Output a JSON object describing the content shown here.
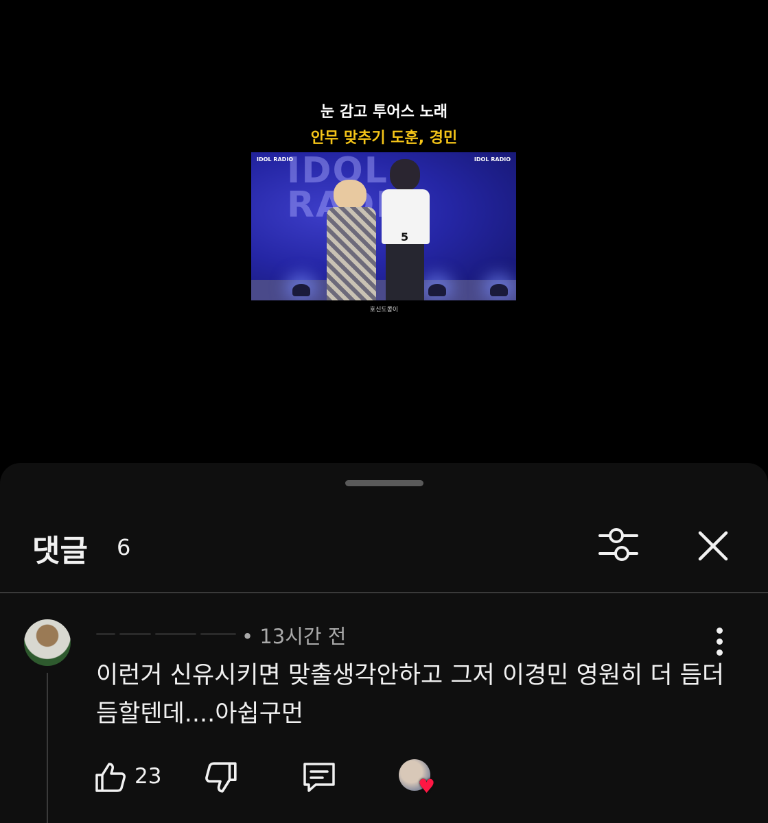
{
  "video": {
    "caption_line1": "눈 감고 투어스 노래",
    "caption_line2": "안무 맞추기 도훈, 경민",
    "thumbnail_text": "IDOL RADIO",
    "logo_left": "IDOL RADIO",
    "logo_right": "IDOL RADIO",
    "jersey_number": "5",
    "watermark": "호신도콩이",
    "caption_highlight_color": "#f5c518"
  },
  "comments_sheet": {
    "title": "댓글",
    "count": "6",
    "filter_icon": "sliders-icon",
    "close_icon": "close-icon"
  },
  "comment": {
    "time": "• 13시간 전",
    "text": "이런거 신유시키면 맞출생각안하고 그저 이경민 영원히 더 듬더듬할텐데....아쉽구먼",
    "likes": "23",
    "like_icon": "thumb-up-icon",
    "dislike_icon": "thumb-down-icon",
    "reply_icon": "reply-icon",
    "more_icon": "more-vert-icon",
    "heart_icon": "heart-icon",
    "heart_color": "#ff1744"
  }
}
